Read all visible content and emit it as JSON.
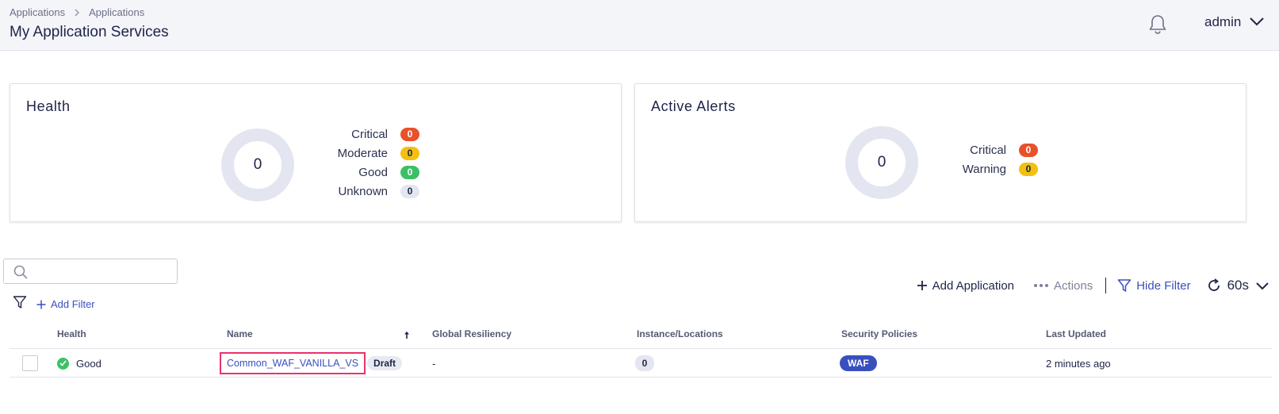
{
  "header": {
    "breadcrumb": [
      "Applications",
      "Applications"
    ],
    "title": "My Application Services",
    "user": "admin"
  },
  "health": {
    "title": "Health",
    "total": "0",
    "legend": [
      {
        "label": "Critical",
        "count": "0",
        "color": "#e8512a"
      },
      {
        "label": "Moderate",
        "count": "0",
        "color": "#f2c00f"
      },
      {
        "label": "Good",
        "count": "0",
        "color": "#3cc066"
      },
      {
        "label": "Unknown",
        "count": "0",
        "color": "#e3e6f0"
      }
    ]
  },
  "alerts": {
    "title": "Active Alerts",
    "total": "0",
    "legend": [
      {
        "label": "Critical",
        "count": "0",
        "color": "#e8512a"
      },
      {
        "label": "Warning",
        "count": "0",
        "color": "#f2c00f"
      }
    ]
  },
  "toolbar": {
    "search_placeholder": "",
    "add_filter": "Add Filter",
    "add_application": "Add Application",
    "actions": "Actions",
    "hide_filter": "Hide Filter",
    "refresh_interval": "60s"
  },
  "table": {
    "columns": [
      "Health",
      "Name",
      "Global Resiliency",
      "Instance/Locations",
      "Security Policies",
      "Last Updated"
    ],
    "rows": [
      {
        "health": "Good",
        "name": "Common_WAF_VANILLA_VS",
        "status": "Draft",
        "global_resiliency": "-",
        "instances": "0",
        "security_policy": "WAF",
        "last_updated": "2 minutes ago"
      }
    ]
  },
  "colors": {
    "accent": "#3a4fbe",
    "highlight": "#e8336c",
    "good": "#3cc066"
  }
}
